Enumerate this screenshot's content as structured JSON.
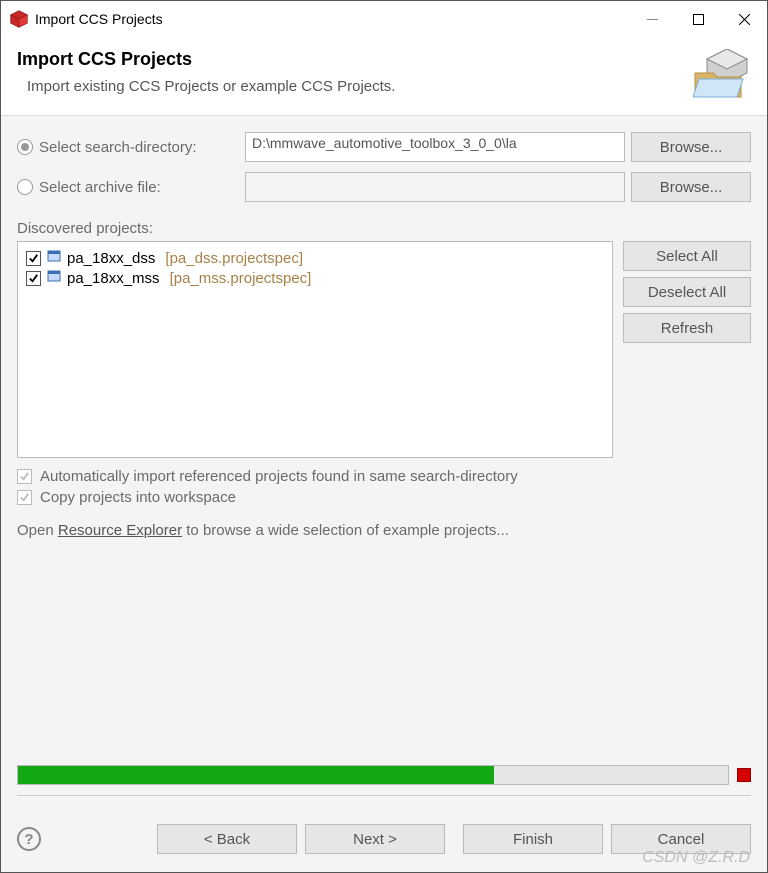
{
  "window": {
    "title": "Import CCS Projects"
  },
  "header": {
    "title": "Import CCS Projects",
    "subtitle": "Import existing CCS Projects or example CCS Projects."
  },
  "source": {
    "searchDirLabel": "Select search-directory:",
    "searchDirValue": "D:\\mmwave_automotive_toolbox_3_0_0\\la",
    "archiveLabel": "Select archive file:",
    "archiveValue": "",
    "browse": "Browse..."
  },
  "discovered": {
    "label": "Discovered projects:",
    "items": [
      {
        "name": "pa_18xx_dss",
        "spec": "[pa_dss.projectspec]",
        "checked": true
      },
      {
        "name": "pa_18xx_mss",
        "spec": "[pa_mss.projectspec]",
        "checked": true
      }
    ],
    "selectAll": "Select All",
    "deselectAll": "Deselect All",
    "refresh": "Refresh"
  },
  "options": {
    "autoImport": "Automatically import referenced projects found in same search-directory",
    "copyWorkspace": "Copy projects into workspace"
  },
  "hint": {
    "prefix": "Open ",
    "link": "Resource Explorer",
    "suffix": " to browse a wide selection of example projects..."
  },
  "progress": {
    "percent": 67
  },
  "footer": {
    "back": "< Back",
    "next": "Next >",
    "finish": "Finish",
    "cancel": "Cancel"
  },
  "watermark": "CSDN @Z.R.D"
}
